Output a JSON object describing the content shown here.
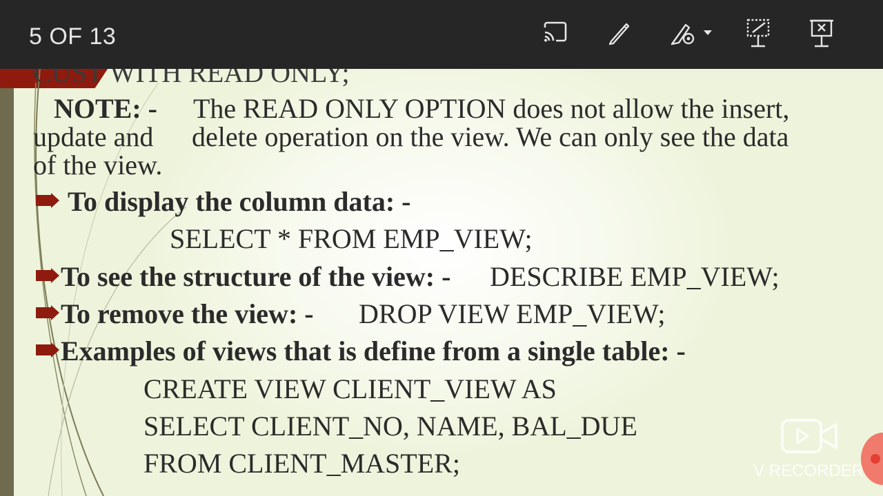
{
  "toolbar": {
    "page_counter": "5 OF 13",
    "buttons": [
      "cast-icon",
      "pen-icon",
      "laser-pointer-icon",
      "resize-slide-icon",
      "close-presentation-icon"
    ]
  },
  "slide": {
    "cut_line": "CUST WITH READ ONLY;",
    "note": {
      "label": "NOTE: -",
      "line1": "The READ ONLY OPTION does not allow the insert,",
      "line2a": "update and",
      "line2b": "delete operation on the view. We can only see the data",
      "line3": "of the view."
    },
    "items": [
      {
        "label": "To display the column data: -",
        "code": "SELECT * FROM EMP_VIEW;"
      },
      {
        "label": "To see the structure of the view: -",
        "code": "DESCRIBE EMP_VIEW;"
      },
      {
        "label": "To remove the view: -",
        "code": "DROP VIEW EMP_VIEW;"
      },
      {
        "label": "Examples of views that is define from a single table: -",
        "code_lines": [
          "CREATE VIEW CLIENT_VIEW AS",
          "SELECT CLIENT_NO, NAME, BAL_DUE",
          "FROM CLIENT_MASTER;"
        ]
      }
    ]
  },
  "watermark": {
    "label": "V RECORDER"
  },
  "colors": {
    "toolbar": "#262626",
    "accent": "#8e1b0e",
    "text": "#2b2b2b"
  }
}
